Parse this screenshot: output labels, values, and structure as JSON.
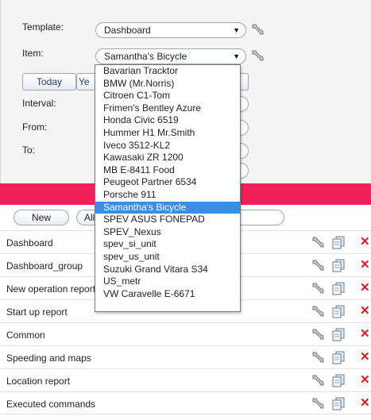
{
  "form": {
    "template_label": "Template:",
    "template_value": "Dashboard",
    "item_label": "Item:",
    "item_value": "Samantha's Bicycle",
    "today_button": "Today",
    "yesterday_button_partial": "Ye",
    "interval_label": "Interval:",
    "from_label": "From:",
    "to_label": "To:"
  },
  "dropdown": {
    "options": [
      "Bavarian Tracktor",
      "BMW (Mr.Norris)",
      "Citroen C1-Tom",
      "Frimen's Bentley Azure",
      "Honda Civic 6519",
      "Hummer H1 Mr.Smith",
      "Iveco 3512-KL2",
      "Kawasaki ZR 1200",
      "MB E-8411 Food",
      "Peugeot Partner 6534",
      "Porsche 911",
      "Samantha's Bicycle",
      "SPEV ASUS FONEPAD",
      "SPEV_Nexus",
      "spev_si_unit",
      "spev_us_unit",
      "Suzuki Grand Vitara S34",
      "US_metr",
      "VW Caravelle E-6671"
    ],
    "selected": "Samantha's Bicycle"
  },
  "toolbar": {
    "new_button": "New",
    "all_button_partial": "All"
  },
  "reports": [
    "Dashboard",
    "Dashboard_group",
    "New operation report",
    "Start up report",
    "Common",
    "Speeding and maps",
    "Location report",
    "Executed commands"
  ],
  "icons": {
    "edit": "wrench-icon",
    "copy": "copy-document-icon",
    "delete": "delete-x-icon"
  },
  "colors": {
    "accent_bar": "#ef2156",
    "selected_option": "#3a8ee6",
    "delete_icon": "#e0162b"
  }
}
